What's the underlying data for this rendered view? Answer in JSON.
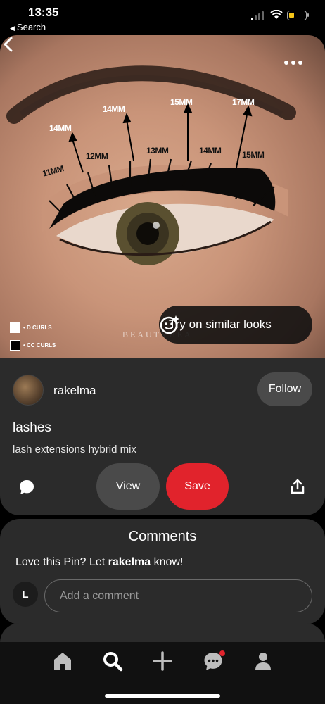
{
  "status_bar": {
    "time": "13:35",
    "back_app": "Search"
  },
  "pin": {
    "image_labels": {
      "measurements": [
        "14MM",
        "14MM",
        "15MM",
        "17MM",
        "11MM",
        "12MM",
        "13MM",
        "14MM",
        "15MM"
      ],
      "legend": [
        "• D CURLS",
        "• CC CURLS"
      ],
      "watermark": "BEAUTYBEA"
    },
    "try_on_label": "Try on similar looks",
    "user": {
      "name": "rakelma",
      "follow_label": "Follow"
    },
    "title": "lashes",
    "description": "lash extensions hybrid mix",
    "actions": {
      "view_label": "View",
      "save_label": "Save"
    }
  },
  "comments": {
    "title": "Comments",
    "prompt_prefix": "Love this Pin? Let ",
    "prompt_user": "rakelma",
    "prompt_suffix": " know!",
    "my_initial": "L",
    "input_placeholder": "Add a comment"
  },
  "bottom_nav": {
    "items": [
      "home-icon",
      "search-icon",
      "add-icon",
      "messages-icon",
      "profile-icon"
    ],
    "messages_has_notification": true
  },
  "colors": {
    "save": "#e1232c",
    "card": "#2b2b2b",
    "button_gray": "#4a4a4a",
    "notification": "#e1232c"
  }
}
